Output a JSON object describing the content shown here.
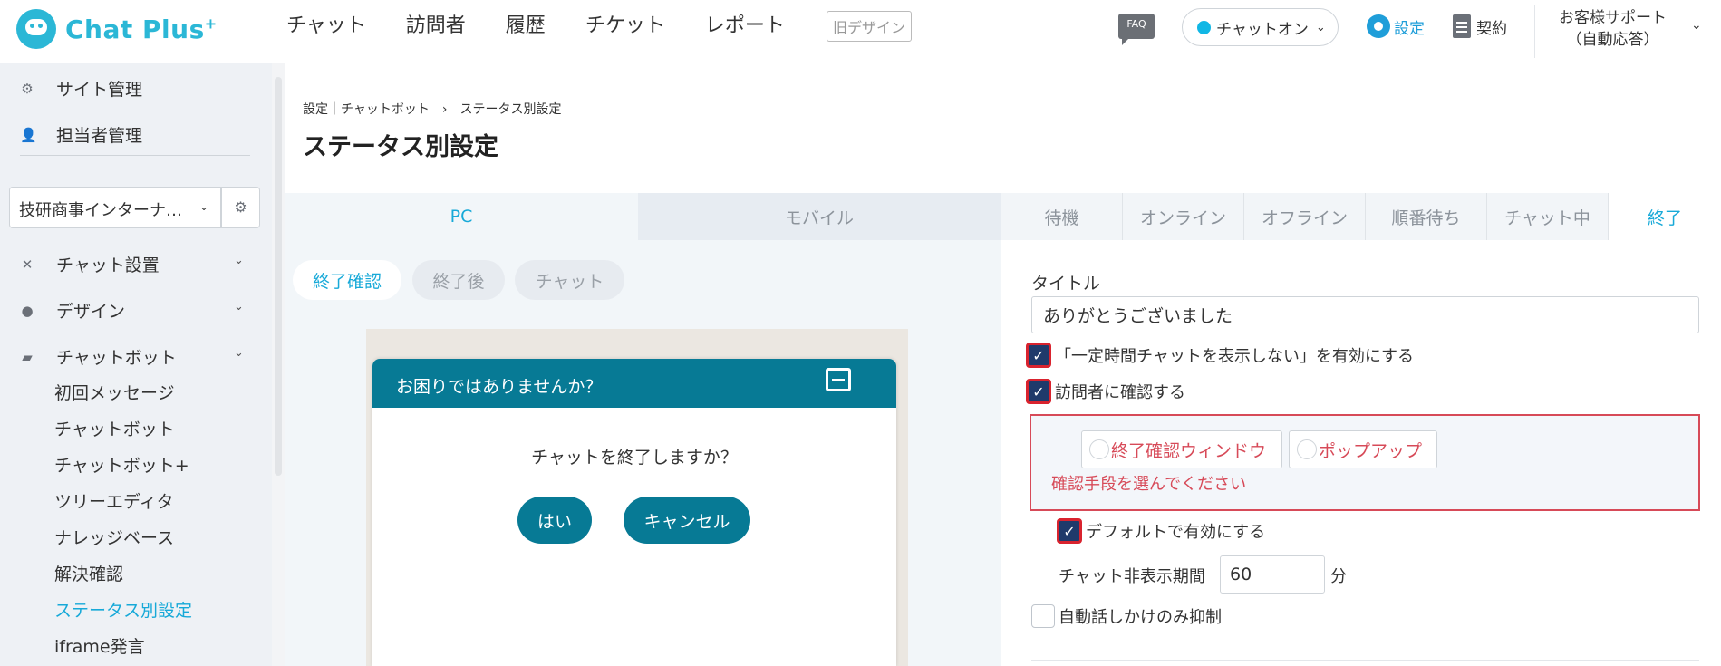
{
  "header": {
    "logo_text": "Chat Plus",
    "logo_sup": "+",
    "nav": [
      "チャット",
      "訪問者",
      "履歴",
      "チケット",
      "レポート"
    ],
    "old_design": "旧デザイン",
    "faq": "FAQ",
    "status": "チャットオン",
    "settings": "設定",
    "contract": "契約",
    "support_line1": "お客様サポート",
    "support_line2": "（自動応答）"
  },
  "sidebar": {
    "site_admin": "サイト管理",
    "staff_admin": "担当者管理",
    "site_select": "技研商事インターナ…",
    "chat_setup": "チャット設置",
    "design": "デザイン",
    "chatbot": "チャットボット",
    "sub_items": [
      "初回メッセージ",
      "チャットボット",
      "チャットボット+",
      "ツリーエディタ",
      "ナレッジベース",
      "解決確認",
      "ステータス別設定",
      "iframe発言"
    ],
    "active_item": "ステータス別設定"
  },
  "breadcrumb": "設定｜チャットボット　›　ステータス別設定",
  "page_title": "ステータス別設定",
  "device_tabs": [
    "PC",
    "モバイル"
  ],
  "status_tabs": [
    "待機",
    "オンライン",
    "オフライン",
    "順番待ち",
    "チャット中",
    "終了"
  ],
  "preview_tabs": [
    "終了確認",
    "終了後",
    "チャット"
  ],
  "preview": {
    "header": "お困りではありませんか？",
    "question": "チャットを終了しますか？",
    "yes": "はい",
    "cancel": "キャンセル"
  },
  "form": {
    "title_label": "タイトル",
    "title_value": "ありがとうございました",
    "cb_hide": "「一定時間チャットを表示しない」を有効にする",
    "cb_confirm": "訪問者に確認する",
    "radio_window": "終了確認ウィンドウ",
    "radio_popup": "ポップアップ",
    "error": "確認手段を選んでください",
    "cb_default": "デフォルトで有効にする",
    "period_label": "チャット非表示期間",
    "period_value": "60",
    "period_unit": "分",
    "cb_auto": "自動話しかけのみ抑制"
  },
  "colors": {
    "accent": "#17a9d8",
    "chat_header": "#077a95",
    "error": "#d74a58"
  }
}
